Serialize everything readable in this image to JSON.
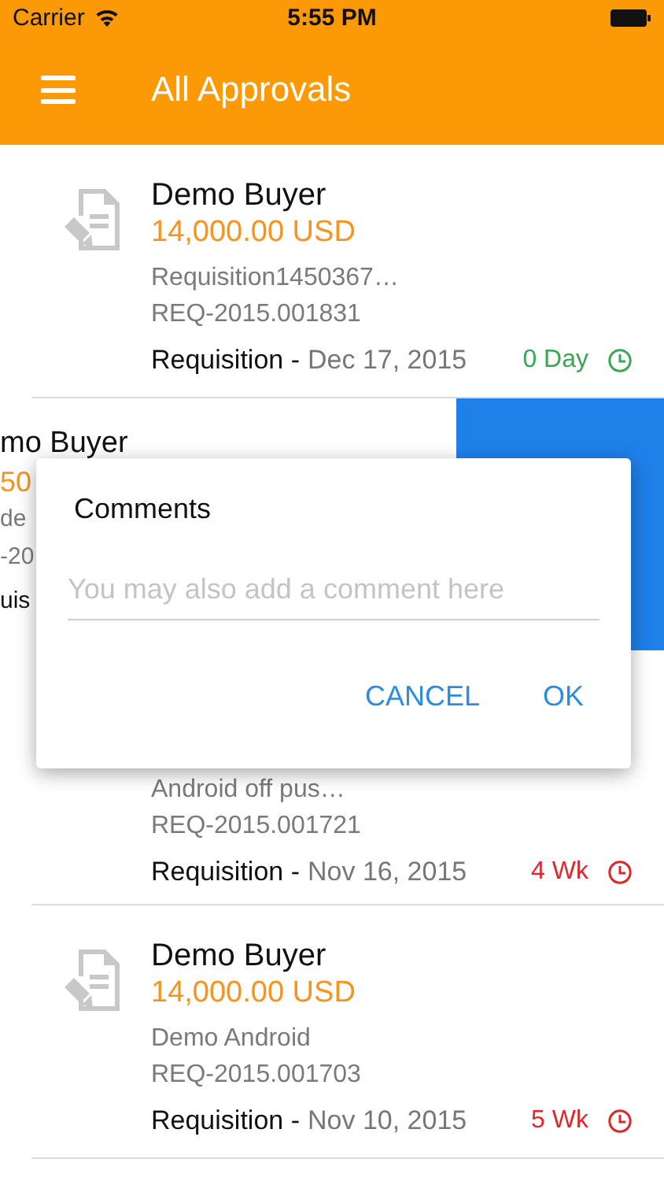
{
  "status_bar": {
    "carrier": "Carrier",
    "time": "5:55 PM"
  },
  "header": {
    "title": "All Approvals"
  },
  "approvals": [
    {
      "kind": "full",
      "name": "Demo Buyer",
      "amount": "14,000.00 USD",
      "title": "Requisition1450367…",
      "reference": "REQ-2015.001831",
      "type": "Requisition -",
      "date": "Dec 17, 2015",
      "age": "0 Day",
      "color": "#3aa757"
    },
    {
      "kind": "swiped",
      "name": "mo Buyer",
      "amount": "50",
      "title": "de",
      "reference": "-20",
      "type": "uis"
    },
    {
      "kind": "partial",
      "title": "Android off pus…",
      "reference": "REQ-2015.001721",
      "type": "Requisition -",
      "date": "Nov 16, 2015",
      "age": "4 Wk",
      "color": "#e0262b"
    },
    {
      "kind": "full",
      "name": "Demo Buyer",
      "amount": "14,000.00 USD",
      "title": "Demo Android",
      "reference": "REQ-2015.001703",
      "type": "Requisition -",
      "date": "Nov 10, 2015",
      "age": "5 Wk",
      "color": "#e0262b"
    }
  ],
  "dialog": {
    "title": "Comments",
    "placeholder": "You may also add a comment here",
    "buttons": [
      "CANCEL",
      "OK"
    ]
  }
}
